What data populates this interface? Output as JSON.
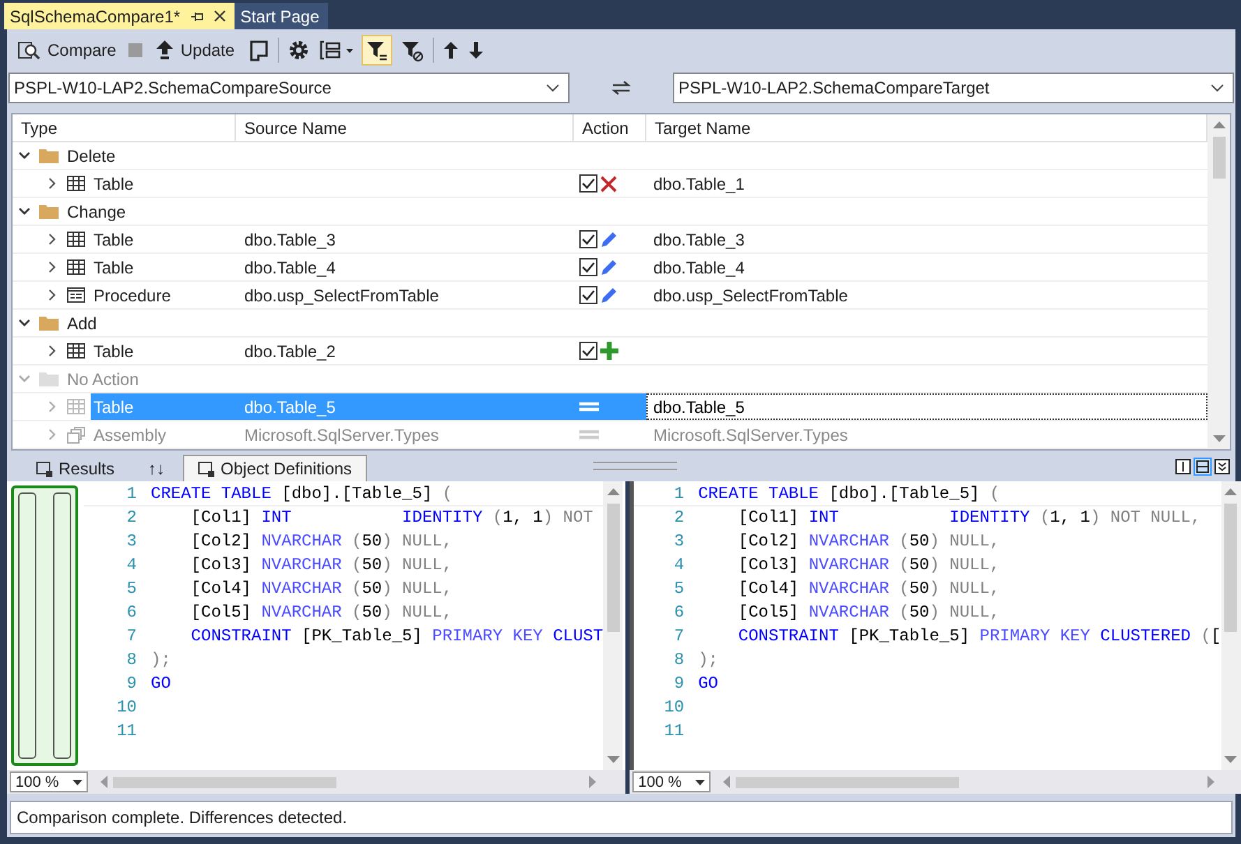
{
  "document_tabs": [
    {
      "label": "SqlSchemaCompare1*",
      "selected": true
    },
    {
      "label": "Start Page",
      "selected": false
    }
  ],
  "toolbar": {
    "compare_label": "Compare",
    "update_label": "Update",
    "filter_selected": true
  },
  "source": {
    "value": "PSPL-W10-LAP2.SchemaCompareSource"
  },
  "target": {
    "value": "PSPL-W10-LAP2.SchemaCompareTarget"
  },
  "grid": {
    "columns": [
      "Type",
      "Source Name",
      "Action",
      "Target Name"
    ],
    "groups": [
      {
        "label": "Delete",
        "expanded": true,
        "disabled": false,
        "rows": [
          {
            "kind": "table",
            "type": "Table",
            "source": "",
            "checked": true,
            "action": {
              "kind": "delete"
            },
            "target": "dbo.Table_1",
            "selected": false,
            "disabled": false
          }
        ]
      },
      {
        "label": "Change",
        "expanded": true,
        "disabled": false,
        "rows": [
          {
            "kind": "table",
            "type": "Table",
            "source": "dbo.Table_3",
            "checked": true,
            "action": {
              "kind": "change"
            },
            "target": "dbo.Table_3",
            "selected": false,
            "disabled": false
          },
          {
            "kind": "table",
            "type": "Table",
            "source": "dbo.Table_4",
            "checked": true,
            "action": {
              "kind": "change"
            },
            "target": "dbo.Table_4",
            "selected": false,
            "disabled": false
          },
          {
            "kind": "procedure",
            "type": "Procedure",
            "source": "dbo.usp_SelectFromTable",
            "checked": true,
            "action": {
              "kind": "change"
            },
            "target": "dbo.usp_SelectFromTable",
            "selected": false,
            "disabled": false
          }
        ]
      },
      {
        "label": "Add",
        "expanded": true,
        "disabled": false,
        "rows": [
          {
            "kind": "table",
            "type": "Table",
            "source": "dbo.Table_2",
            "checked": true,
            "action": {
              "kind": "add"
            },
            "target": "",
            "selected": false,
            "disabled": false
          }
        ]
      },
      {
        "label": "No Action",
        "expanded": true,
        "disabled": true,
        "rows": [
          {
            "kind": "table",
            "type": "Table",
            "source": "dbo.Table_5",
            "action": {
              "kind": "none"
            },
            "target": "dbo.Table_5",
            "selected": true,
            "disabled": true
          },
          {
            "kind": "assembly",
            "type": "Assembly",
            "source": "Microsoft.SqlServer.Types",
            "action": {
              "kind": "none"
            },
            "target": "Microsoft.SqlServer.Types",
            "selected": false,
            "disabled": true
          }
        ]
      }
    ]
  },
  "bottom_tabs": [
    {
      "label": "Results",
      "selected": false
    },
    {
      "label": "↑↓",
      "selected": false
    },
    {
      "label": "Object Definitions",
      "selected": true
    }
  ],
  "panes": [
    {
      "zoom": "100 %",
      "lines": [
        {
          "number": "1",
          "tokens": [
            {
              "text": "CREATE TABLE ",
              "kind": "kw"
            },
            {
              "text": "[dbo].[Table_5] ",
              "kind": "id"
            },
            {
              "text": "(",
              "kind": "op"
            }
          ]
        },
        {
          "number": "2",
          "tokens": [
            {
              "text": "    [Col1] ",
              "kind": "id"
            },
            {
              "text": "INT           ",
              "kind": "kw"
            },
            {
              "text": "IDENTITY ",
              "kind": "kw"
            },
            {
              "text": "(",
              "kind": "op"
            },
            {
              "text": "1, 1",
              "kind": "id"
            },
            {
              "text": ") NOT",
              "kind": "op"
            }
          ]
        },
        {
          "number": "3",
          "tokens": [
            {
              "text": "    [Col2] ",
              "kind": "id"
            },
            {
              "text": "NVARCHAR ",
              "kind": "fn"
            },
            {
              "text": "(",
              "kind": "op"
            },
            {
              "text": "50",
              "kind": "id"
            },
            {
              "text": ") NULL,",
              "kind": "op"
            }
          ]
        },
        {
          "number": "4",
          "tokens": [
            {
              "text": "    [Col3] ",
              "kind": "id"
            },
            {
              "text": "NVARCHAR ",
              "kind": "fn"
            },
            {
              "text": "(",
              "kind": "op"
            },
            {
              "text": "50",
              "kind": "id"
            },
            {
              "text": ") NULL,",
              "kind": "op"
            }
          ]
        },
        {
          "number": "5",
          "tokens": [
            {
              "text": "    [Col4] ",
              "kind": "id"
            },
            {
              "text": "NVARCHAR ",
              "kind": "fn"
            },
            {
              "text": "(",
              "kind": "op"
            },
            {
              "text": "50",
              "kind": "id"
            },
            {
              "text": ") NULL,",
              "kind": "op"
            }
          ]
        },
        {
          "number": "6",
          "tokens": [
            {
              "text": "    [Col5] ",
              "kind": "id"
            },
            {
              "text": "NVARCHAR ",
              "kind": "fn"
            },
            {
              "text": "(",
              "kind": "op"
            },
            {
              "text": "50",
              "kind": "id"
            },
            {
              "text": ") NULL,",
              "kind": "op"
            }
          ]
        },
        {
          "number": "7",
          "tokens": [
            {
              "text": "    CONSTRAINT ",
              "kind": "kw"
            },
            {
              "text": "[PK_Table_5] ",
              "kind": "id"
            },
            {
              "text": "PRIMARY KEY ",
              "kind": "fn"
            },
            {
              "text": "CLUST",
              "kind": "kw"
            }
          ]
        },
        {
          "number": "8",
          "tokens": [
            {
              "text": ");",
              "kind": "op"
            }
          ]
        },
        {
          "number": "9",
          "tokens": [
            {
              "text": "GO",
              "kind": "kw"
            }
          ]
        },
        {
          "number": "10"
        },
        {
          "number": "11"
        }
      ]
    },
    {
      "zoom": "100 %",
      "lines": [
        {
          "number": "1",
          "tokens": [
            {
              "text": "CREATE TABLE ",
              "kind": "kw"
            },
            {
              "text": "[dbo].[Table_5] ",
              "kind": "id"
            },
            {
              "text": "(",
              "kind": "op"
            }
          ]
        },
        {
          "number": "2",
          "tokens": [
            {
              "text": "    [Col1] ",
              "kind": "id"
            },
            {
              "text": "INT           ",
              "kind": "kw"
            },
            {
              "text": "IDENTITY ",
              "kind": "kw"
            },
            {
              "text": "(",
              "kind": "op"
            },
            {
              "text": "1, 1",
              "kind": "id"
            },
            {
              "text": ") NOT NULL,",
              "kind": "op"
            }
          ]
        },
        {
          "number": "3",
          "tokens": [
            {
              "text": "    [Col2] ",
              "kind": "id"
            },
            {
              "text": "NVARCHAR ",
              "kind": "fn"
            },
            {
              "text": "(",
              "kind": "op"
            },
            {
              "text": "50",
              "kind": "id"
            },
            {
              "text": ") NULL,",
              "kind": "op"
            }
          ]
        },
        {
          "number": "4",
          "tokens": [
            {
              "text": "    [Col3] ",
              "kind": "id"
            },
            {
              "text": "NVARCHAR ",
              "kind": "fn"
            },
            {
              "text": "(",
              "kind": "op"
            },
            {
              "text": "50",
              "kind": "id"
            },
            {
              "text": ") NULL,",
              "kind": "op"
            }
          ]
        },
        {
          "number": "5",
          "tokens": [
            {
              "text": "    [Col4] ",
              "kind": "id"
            },
            {
              "text": "NVARCHAR ",
              "kind": "fn"
            },
            {
              "text": "(",
              "kind": "op"
            },
            {
              "text": "50",
              "kind": "id"
            },
            {
              "text": ") NULL,",
              "kind": "op"
            }
          ]
        },
        {
          "number": "6",
          "tokens": [
            {
              "text": "    [Col5] ",
              "kind": "id"
            },
            {
              "text": "NVARCHAR ",
              "kind": "fn"
            },
            {
              "text": "(",
              "kind": "op"
            },
            {
              "text": "50",
              "kind": "id"
            },
            {
              "text": ") NULL,",
              "kind": "op"
            }
          ]
        },
        {
          "number": "7",
          "tokens": [
            {
              "text": "    CONSTRAINT ",
              "kind": "kw"
            },
            {
              "text": "[PK_Table_5] ",
              "kind": "id"
            },
            {
              "text": "PRIMARY KEY ",
              "kind": "fn"
            },
            {
              "text": "CLUSTERED ",
              "kind": "kw"
            },
            {
              "text": "(",
              "kind": "op"
            },
            {
              "text": "[",
              "kind": "id"
            }
          ]
        },
        {
          "number": "8",
          "tokens": [
            {
              "text": ");",
              "kind": "op"
            }
          ]
        },
        {
          "number": "9",
          "tokens": [
            {
              "text": "GO",
              "kind": "kw"
            }
          ]
        },
        {
          "number": "10"
        },
        {
          "number": "11"
        }
      ]
    }
  ],
  "status_bar": {
    "text": "Comparison complete.  Differences detected."
  }
}
